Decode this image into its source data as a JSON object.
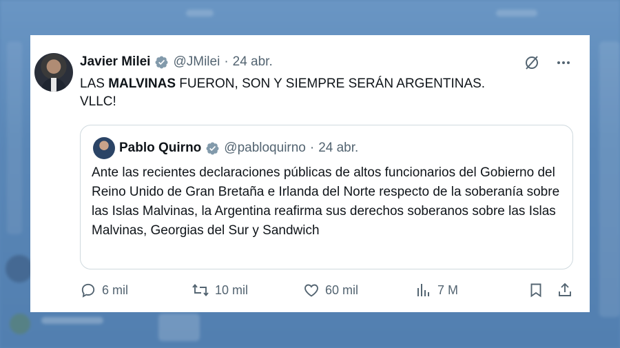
{
  "author": {
    "name": "Javier Milei",
    "handle": "@JMilei",
    "separator": "·",
    "date": "24 abr."
  },
  "tweet": {
    "text_before": "LAS ",
    "text_bold": "MALVINAS",
    "text_after": " FUERON, SON Y SIEMPRE SERÁN ARGENTINAS.",
    "line2": "VLLC!"
  },
  "quote": {
    "name": "Pablo Quirno",
    "handle": "@pabloquirno",
    "separator": "·",
    "date": "24 abr.",
    "text": "Ante las recientes declaraciones públicas de altos funcionarios del Gobierno del Reino Unido de Gran Bretaña e Irlanda del Norte respecto de la soberanía sobre las Islas Malvinas, la Argentina reafirma sus derechos soberanos sobre las Islas Malvinas, Georgias del Sur y Sandwich"
  },
  "actions": {
    "replies": "6 mil",
    "retweets": "10 mil",
    "likes": "60 mil",
    "views": "7 M"
  },
  "icons": [
    "verified-badge-icon",
    "grok-icon",
    "more-icon",
    "reply-icon",
    "retweet-icon",
    "like-icon",
    "views-icon",
    "bookmark-icon",
    "share-icon"
  ],
  "colors": {
    "verified": "#829aab",
    "text": "#0f1419",
    "muted": "#536471",
    "border": "#cfd9de",
    "background": "#5b88b8"
  }
}
